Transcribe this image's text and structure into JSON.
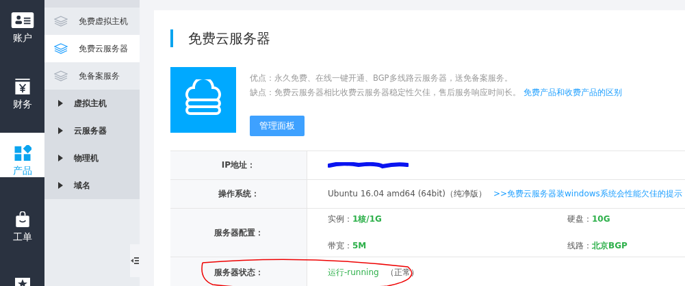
{
  "nav_rail": [
    {
      "label": "账户",
      "kind": "account",
      "selected": false
    },
    {
      "label": "财务",
      "kind": "finance",
      "selected": false
    },
    {
      "label": "产品",
      "kind": "product",
      "selected": true
    },
    {
      "label": "工单",
      "kind": "ticket",
      "selected": false
    },
    {
      "kind": "star",
      "selected": false
    }
  ],
  "submenu": [
    {
      "kind": "service",
      "label": "免费虚拟主机",
      "selected": false
    },
    {
      "kind": "service",
      "label": "免费云服务器",
      "selected": true
    },
    {
      "kind": "service",
      "label": "免备案服务",
      "selected": false
    },
    {
      "kind": "category",
      "label": "虚拟主机",
      "expanded": false
    },
    {
      "kind": "category",
      "label": "云服务器",
      "expanded": false
    },
    {
      "kind": "category",
      "label": "物理机",
      "expanded": false
    },
    {
      "kind": "category",
      "label": "域名",
      "expanded": false
    }
  ],
  "page_title": "免费云服务器",
  "intro": {
    "pros": "优点：永久免费、在线一键开通、BGP多线路云服务器，送免备案服务。",
    "cons": "缺点：免费云服务器相比收费云服务器稳定性欠佳，售后服务响应时间长。",
    "cons_link": "免费产品和收费产品的区别",
    "button": "管理面板"
  },
  "details": [
    {
      "kind": "redacted",
      "label": "IP地址："
    },
    {
      "kind": "os",
      "label": "操作系统：",
      "value": "Ubuntu 16.04 amd64 (64bit)（纯净版）",
      "link": ">>免费云服务器装windows系统会性能欠佳的提示"
    },
    {
      "kind": "specs",
      "label": "服务器配置：",
      "specs": [
        {
          "name": "实例：",
          "value": "1核/1G"
        },
        {
          "name": "硬盘：",
          "value": "10G"
        },
        {
          "name": "带宽：",
          "value": "5M"
        },
        {
          "name": "线路：",
          "value": "北京BGP"
        }
      ]
    },
    {
      "kind": "status",
      "label": "服务器状态：",
      "value": "运行-running",
      "note": "（正常）",
      "circled": true
    }
  ]
}
